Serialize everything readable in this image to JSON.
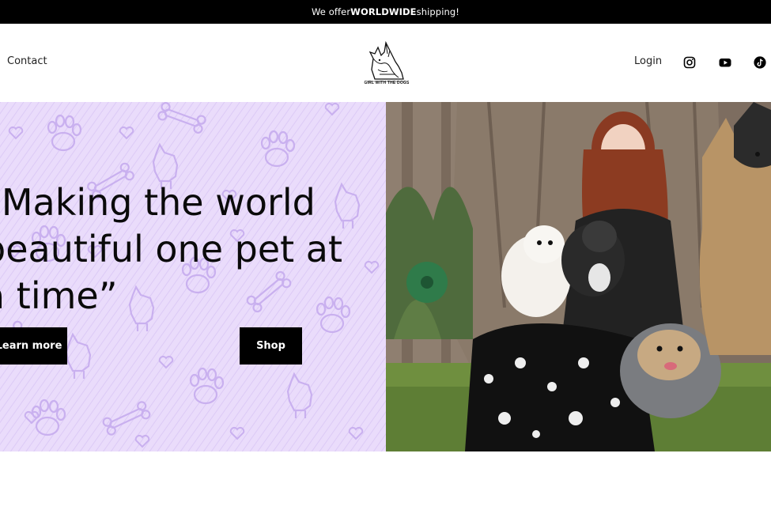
{
  "announcement": {
    "prefix": "We offer ",
    "bold": "WORLDWIDE",
    "suffix": " shipping!"
  },
  "header": {
    "nav_contact": "Contact",
    "logo_text": "GIRL WITH THE DOGS",
    "login": "Login",
    "social_icons": [
      "instagram-icon",
      "youtube-icon",
      "tiktok-icon"
    ]
  },
  "hero": {
    "headline_lines": [
      "“Making the world",
      "beautiful one pet at",
      "a time”"
    ],
    "learn_more": "Learn more",
    "shop": "Shop",
    "pattern_color": "#eadcfb",
    "photo_alt": "Woman sitting in front of a tree holding several dogs"
  },
  "colors": {
    "announcement_bg": "#000000",
    "hero_pattern": "#eadcfb",
    "pattern_stroke": "#c9b0ef",
    "button_bg": "#000000"
  }
}
